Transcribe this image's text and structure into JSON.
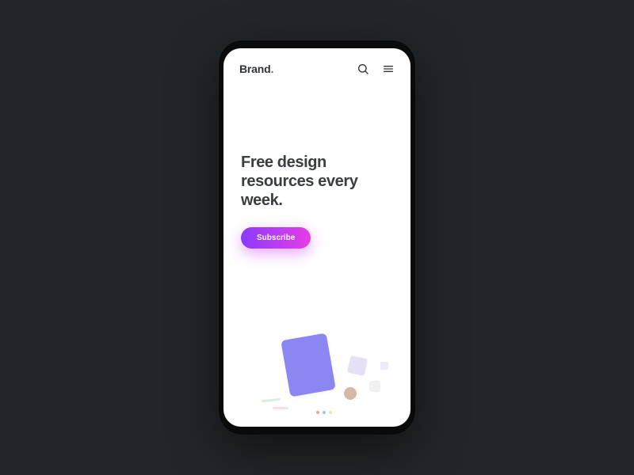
{
  "header": {
    "brand": "Brand",
    "brand_suffix": "."
  },
  "hero": {
    "headline": "Free design resources every week.",
    "cta_label": "Subscribe"
  }
}
